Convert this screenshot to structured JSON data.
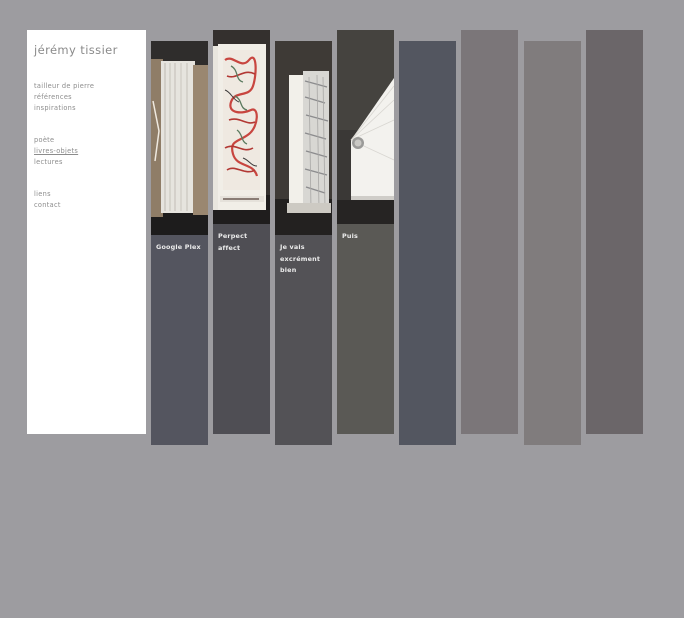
{
  "site": {
    "title": "jérémy tissier"
  },
  "nav": {
    "group1": [
      {
        "label": "tailleur de pierre",
        "active": false
      },
      {
        "label": "références",
        "active": false
      },
      {
        "label": "inspirations",
        "active": false
      }
    ],
    "group2": [
      {
        "label": "poète",
        "active": false
      },
      {
        "label": "livres-objets",
        "active": true
      },
      {
        "label": "lectures",
        "active": false
      }
    ],
    "group3": [
      {
        "label": "liens",
        "active": false
      },
      {
        "label": "contact",
        "active": false
      }
    ]
  },
  "columns": [
    {
      "label": "Google Plex",
      "color": "#54555f",
      "has_image": true
    },
    {
      "label": "Perpect affect",
      "color": "#4f4e54",
      "has_image": true
    },
    {
      "label": "Je vais excrément bien",
      "color": "#535256",
      "has_image": true
    },
    {
      "label": "Puis",
      "color": "#5a5955",
      "has_image": true
    },
    {
      "label": "",
      "color": "#535660",
      "has_image": false
    },
    {
      "label": "",
      "color": "#7b7679",
      "has_image": false
    },
    {
      "label": "",
      "color": "#807c7d",
      "has_image": false
    },
    {
      "label": "",
      "color": "#6b6669",
      "has_image": false
    }
  ]
}
